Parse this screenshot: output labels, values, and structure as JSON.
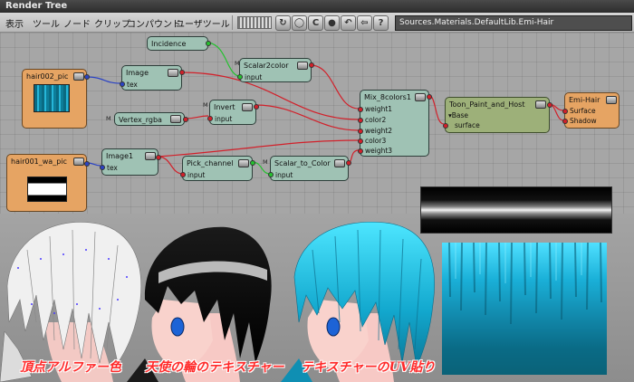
{
  "window": {
    "title": "Render Tree"
  },
  "menu": [
    {
      "label": "表示"
    },
    {
      "label": "ツール"
    },
    {
      "label": "ノード"
    },
    {
      "label": "クリップ"
    },
    {
      "label": "コンパウンド"
    },
    {
      "label": "ユーザツール"
    }
  ],
  "toolbar": {
    "buttons": [
      {
        "icon": "refresh-icon",
        "glyph": "↻"
      },
      {
        "icon": "circle-icon",
        "glyph": "◯"
      },
      {
        "icon": "c-icon",
        "glyph": "C"
      },
      {
        "icon": "sphere-icon",
        "glyph": "●"
      },
      {
        "icon": "undo-icon",
        "glyph": "↶"
      },
      {
        "icon": "back-arrow-icon",
        "glyph": "⇦"
      },
      {
        "icon": "help-icon",
        "glyph": "?"
      }
    ],
    "path": "Sources.Materials.DefaultLib.Emi-Hair"
  },
  "nodes": {
    "incidence": {
      "title": "Incidence"
    },
    "scalar2color": {
      "title": "Scalar2color",
      "ports": [
        "input"
      ]
    },
    "hair002": {
      "title": "hair002_pic"
    },
    "image": {
      "title": "Image",
      "ports": [
        "tex"
      ]
    },
    "vertex": {
      "title": "Vertex_rgba"
    },
    "invert": {
      "title": "Invert",
      "ports": [
        "input"
      ]
    },
    "mix": {
      "title": "Mix_8colors1",
      "ports": [
        "weight1",
        "color2",
        "weight2",
        "color3",
        "weight3"
      ]
    },
    "toon": {
      "title": "Toon_Paint_and_Host",
      "ports": [
        "Base",
        "surface"
      ]
    },
    "emi": {
      "title": "Emi-Hair",
      "ports": [
        "Surface",
        "Shadow"
      ]
    },
    "hair001": {
      "title": "hair001_wa_pic"
    },
    "image1": {
      "title": "Image1",
      "ports": [
        "tex"
      ]
    },
    "pick": {
      "title": "Pick_channel",
      "ports": [
        "input"
      ]
    },
    "s2c": {
      "title": "Scalar_to_Color",
      "ports": [
        "input"
      ]
    },
    "m_label": "M"
  },
  "captions": [
    "頂点アルファー色",
    "天使の輪のテキスチャー",
    "テキスチャーのUV貼り"
  ],
  "colors": {
    "wire_red": "#d2202a",
    "wire_blue": "#2b43c4",
    "wire_green": "#25c130",
    "node_teal": "#9fc2b4",
    "node_orange": "#e6a463",
    "node_olive": "#9db079",
    "caption": "#ff2a2a"
  }
}
